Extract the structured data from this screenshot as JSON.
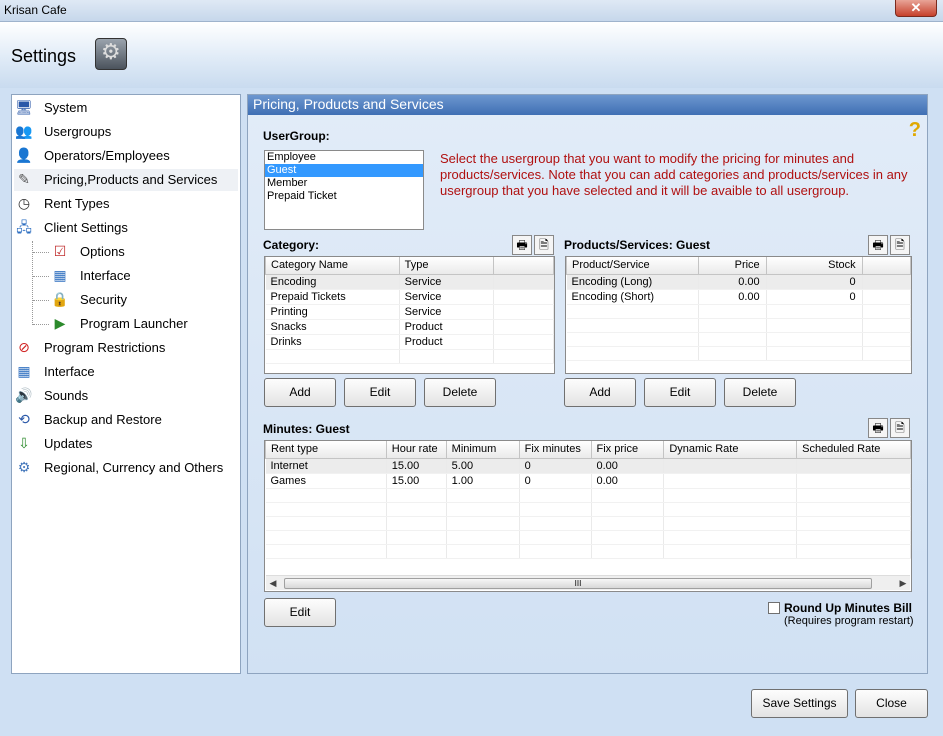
{
  "window": {
    "title": "Krisan Cafe",
    "close_symbol": "✕"
  },
  "header": {
    "title": "Settings"
  },
  "nav": {
    "items": [
      {
        "label": "System",
        "icon": "computer-icon"
      },
      {
        "label": "Usergroups",
        "icon": "users-icon"
      },
      {
        "label": "Operators/Employees",
        "icon": "operator-icon"
      },
      {
        "label": "Pricing,Products and Services",
        "icon": "pricing-icon"
      },
      {
        "label": "Rent Types",
        "icon": "clock-icon"
      },
      {
        "label": "Client Settings",
        "icon": "network-icon"
      },
      {
        "label": "Options",
        "icon": "checklist-icon"
      },
      {
        "label": "Interface",
        "icon": "grid-icon"
      },
      {
        "label": "Security",
        "icon": "lock-icon"
      },
      {
        "label": "Program Launcher",
        "icon": "launcher-icon"
      },
      {
        "label": "Program Restrictions",
        "icon": "no-entry-icon"
      },
      {
        "label": "Interface",
        "icon": "grid-icon"
      },
      {
        "label": "Sounds",
        "icon": "speaker-icon"
      },
      {
        "label": "Backup and Restore",
        "icon": "backup-icon"
      },
      {
        "label": "Updates",
        "icon": "updates-icon"
      },
      {
        "label": "Regional, Currency and Others",
        "icon": "gears-icon"
      }
    ]
  },
  "panel": {
    "title": "Pricing, Products and Services",
    "help": "?",
    "usergroup_label": "UserGroup:",
    "usergroups": [
      "Employee",
      "Guest",
      "Member",
      "Prepaid Ticket"
    ],
    "selected_usergroup": "Guest",
    "note": "Select the usergroup that you want to modify  the pricing for minutes and products/services. Note that you can add categories and products/services in any usergroup that you have selected and it will be avaible to all usergroup.",
    "category": {
      "label": "Category:",
      "columns": [
        "Category Name",
        "Type"
      ],
      "rows": [
        [
          "Encoding",
          "Service"
        ],
        [
          "Prepaid Tickets",
          "Service"
        ],
        [
          "Printing",
          "Service"
        ],
        [
          "Snacks",
          "Product"
        ],
        [
          "Drinks",
          "Product"
        ]
      ],
      "buttons": {
        "add": "Add",
        "edit": "Edit",
        "delete": "Delete"
      }
    },
    "products": {
      "label": "Products/Services: Guest",
      "columns": [
        "Product/Service",
        "Price",
        "Stock"
      ],
      "rows": [
        [
          "Encoding (Long)",
          "0.00",
          "0"
        ],
        [
          "Encoding (Short)",
          "0.00",
          "0"
        ]
      ],
      "buttons": {
        "add": "Add",
        "edit": "Edit",
        "delete": "Delete"
      }
    },
    "minutes": {
      "label": "Minutes: Guest",
      "columns": [
        "Rent type",
        "Hour rate",
        "Minimum",
        "Fix minutes",
        "Fix price",
        "Dynamic Rate",
        "Scheduled Rate"
      ],
      "rows": [
        [
          "Internet",
          "15.00",
          "5.00",
          "0",
          "0.00",
          "",
          ""
        ],
        [
          "Games",
          "15.00",
          "1.00",
          "0",
          "0.00",
          "",
          ""
        ]
      ],
      "edit_button": "Edit",
      "scroll_thumb": "III",
      "scroll_left": "◀",
      "scroll_right": "▶"
    },
    "round_up": {
      "label": "Round Up Minutes Bill",
      "sublabel": "(Requires program restart)",
      "checked": false
    },
    "print_icon": "🖶",
    "export_icon": "🗎"
  },
  "footer": {
    "save": "Save Settings",
    "close": "Close"
  }
}
